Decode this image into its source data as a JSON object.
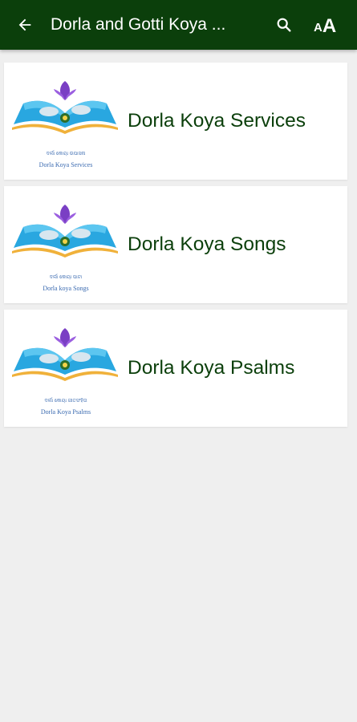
{
  "appbar": {
    "title": "Dorla and  Gotti Koya ...",
    "back_icon": "arrow-back-icon",
    "search_icon": "search-icon",
    "font_size_icon": "font-size-icon",
    "font_size_small": "A",
    "font_size_big": "A",
    "background_color": "#0b3f0b"
  },
  "items": [
    {
      "label": "Dorla Koya Services",
      "logo_caption_line1": "ଦର୍ଲା କୋୟା ଉପାସନା",
      "logo_caption_line2": "Dorla Koya Services",
      "logo_icon": "open-bible-logo-icon"
    },
    {
      "label": "Dorla Koya Songs",
      "logo_caption_line1": "ଦର୍ଲା କୋୟା ପାଟା",
      "logo_caption_line2": "Dorla koya Songs",
      "logo_icon": "open-bible-logo-icon"
    },
    {
      "label": "Dorla Koya Psalms",
      "logo_caption_line1": "ଦର୍ଲା କୋୟା ଗୀତସଂହିତା",
      "logo_caption_line2": "Dorla Koya Psalms",
      "logo_icon": "open-bible-logo-icon"
    }
  ],
  "colors": {
    "label": "#0b3f0b",
    "page_background": "#efefef"
  }
}
